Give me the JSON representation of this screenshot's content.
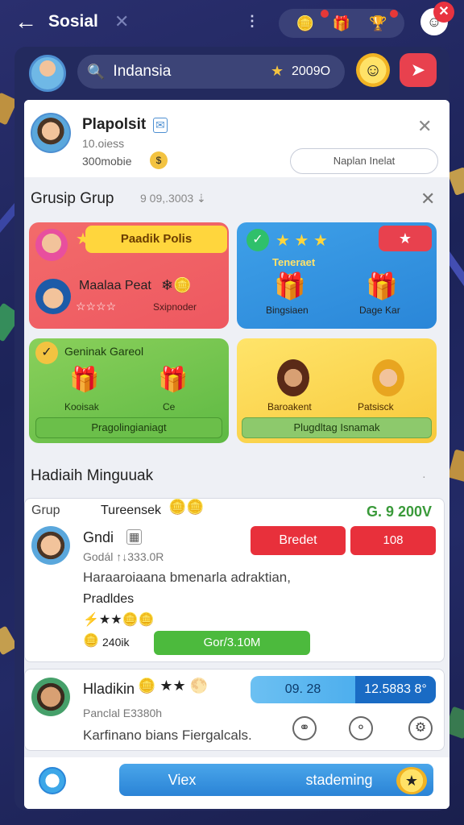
{
  "app": {
    "title": "Sosial"
  },
  "topbar": {
    "back_icon": "arrow-left-icon",
    "close_icon": "close-icon",
    "menu_icon": "vertical-dots-icon",
    "status_icons": [
      "coin-icon",
      "gift-icon",
      "trophy-icon"
    ],
    "profile_close_icon": "close-icon"
  },
  "search": {
    "value": "Indansia",
    "coin_value": "2009O"
  },
  "profile": {
    "name": "Plapolsit",
    "sub": "10.oiess",
    "coins": "300mobie",
    "action_label": "Naplan Inelat"
  },
  "groups": {
    "title": "Grusip Grup",
    "meta": "9 09,.3003 ⇣",
    "tiles": [
      {
        "banner": "Paadik Polis",
        "name": "Maalaa Peat",
        "sub": "Sxipnoder",
        "rating": "☆☆☆☆"
      },
      {
        "label": "Teneraet",
        "caption_left": "Bingsiaen",
        "caption_right": "Dage Kar"
      },
      {
        "header": "Geninak Gareol",
        "caption_left": "Kooisak",
        "caption_right": "Ce",
        "bar": "Pragolingianiagt"
      },
      {
        "caption_left": "Baroakent",
        "caption_right": "Patsisck",
        "bar": "Plugdltag Isnamak"
      }
    ]
  },
  "weekly": {
    "title": "Hadiaih Minguuak",
    "more_icon": "chevron-down-icon"
  },
  "card1": {
    "group_label": "Grup",
    "turn_label": "Tureensek",
    "amount": "G. 9 200V",
    "name": "Gndi",
    "sub": "Godál ↑↓333.0R",
    "red_button_1": "Bredet",
    "red_button_2": "108",
    "description": "Haraaroiaana bmenarla adraktian,",
    "label": "Pradldes",
    "coin_value": "240ik",
    "green_button": "Gor/3.10M"
  },
  "card2": {
    "name": "Hladikin",
    "sub": "Panclal E3380h",
    "description": "Karfinano bians Fiergalcals.",
    "pill_left": "09. 28",
    "pill_right": "12.5883 8°"
  },
  "bottom": {
    "left_button": "Viex",
    "right_button": "stademing"
  },
  "colors": {
    "background": "#232a66",
    "accent_blue": "#2a86d8",
    "accent_red": "#e8303b",
    "accent_green": "#4cba3d",
    "coin_gold": "#f3c341"
  }
}
